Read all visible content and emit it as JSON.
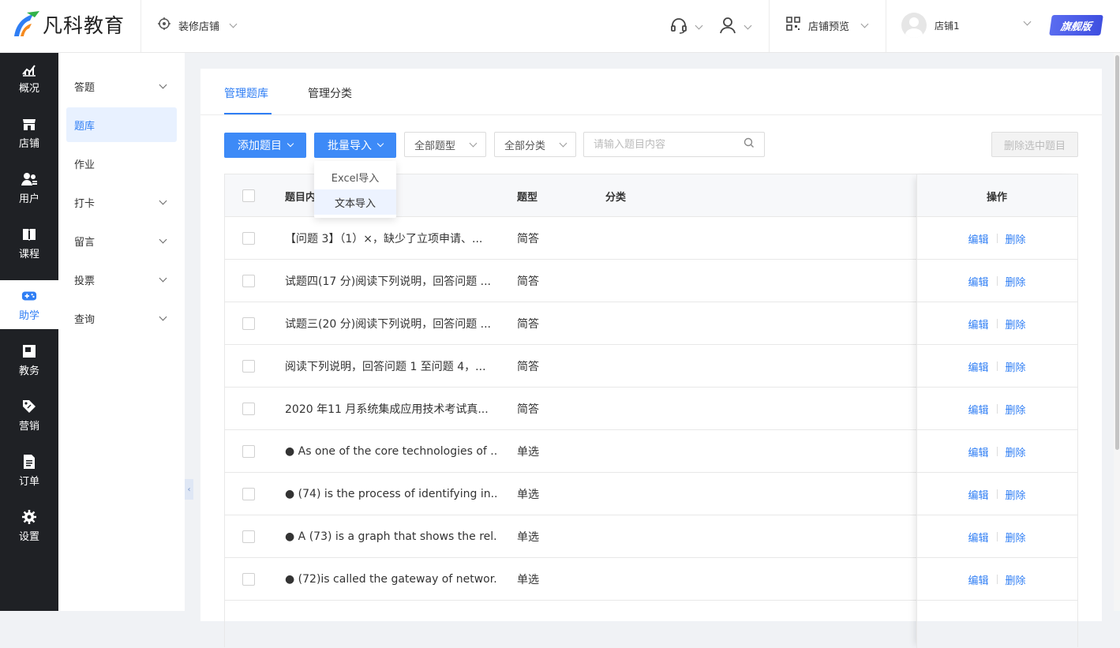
{
  "app": {
    "brand": "凡科教育"
  },
  "topbar": {
    "decorate_label": "装修店铺",
    "preview_label": "店铺预览",
    "shop_name": "店铺1",
    "badge": "旗舰版"
  },
  "sidebar": {
    "items": [
      {
        "label": "概况",
        "icon": "chart-icon"
      },
      {
        "label": "店铺",
        "icon": "store-icon"
      },
      {
        "label": "用户",
        "icon": "users-icon"
      },
      {
        "label": "课程",
        "icon": "book-icon"
      },
      {
        "label": "助学",
        "icon": "gamepad-icon"
      },
      {
        "label": "教务",
        "icon": "calendar-icon"
      },
      {
        "label": "营销",
        "icon": "tag-icon"
      },
      {
        "label": "订单",
        "icon": "document-icon"
      },
      {
        "label": "设置",
        "icon": "gear-icon"
      }
    ],
    "active_index": 4
  },
  "submenu": {
    "items": [
      {
        "label": "答题",
        "expandable": true
      },
      {
        "label": "题库",
        "expandable": false
      },
      {
        "label": "作业",
        "expandable": false
      },
      {
        "label": "打卡",
        "expandable": true
      },
      {
        "label": "留言",
        "expandable": true
      },
      {
        "label": "投票",
        "expandable": true
      },
      {
        "label": "查询",
        "expandable": true
      }
    ],
    "active_index": 1
  },
  "tabs": [
    {
      "label": "管理题库"
    },
    {
      "label": "管理分类"
    }
  ],
  "toolbar": {
    "add_label": "添加题目",
    "import_label": "批量导入",
    "type_filter": "全部题型",
    "category_filter": "全部分类",
    "search_placeholder": "请输入题目内容",
    "delete_selected": "删除选中题目"
  },
  "import_menu": {
    "items": [
      "Excel导入",
      "文本导入"
    ]
  },
  "table": {
    "headers": {
      "content": "题目内容",
      "type": "题型",
      "category": "分类",
      "actions": "操作"
    },
    "edit_label": "编辑",
    "delete_label": "删除",
    "rows": [
      {
        "content": "【问题 3】（1）×，缺少了立项申请、...",
        "type": "简答",
        "category": ""
      },
      {
        "content": "试题四(17 分)阅读下列说明，回答问题 ...",
        "type": "简答",
        "category": ""
      },
      {
        "content": "试题三(20 分)阅读下列说明，回答问题 ...",
        "type": "简答",
        "category": ""
      },
      {
        "content": "阅读下列说明，回答问题 1 至问题 4，...",
        "type": "简答",
        "category": ""
      },
      {
        "content": "2020 年11 月系统集成应用技术考试真...",
        "type": "简答",
        "category": ""
      },
      {
        "content": "● As one of the core technologies of ...",
        "type": "单选",
        "category": ""
      },
      {
        "content": "● (74) is the process of identifying in...",
        "type": "单选",
        "category": ""
      },
      {
        "content": "● A (73) is a graph that shows the rel...",
        "type": "单选",
        "category": ""
      },
      {
        "content": "● (72)is called the gateway of networ...",
        "type": "单选",
        "category": ""
      }
    ]
  },
  "colors": {
    "primary": "#3d8af7",
    "link": "#2f7ef4",
    "sidebar_bg": "#1f2125"
  }
}
